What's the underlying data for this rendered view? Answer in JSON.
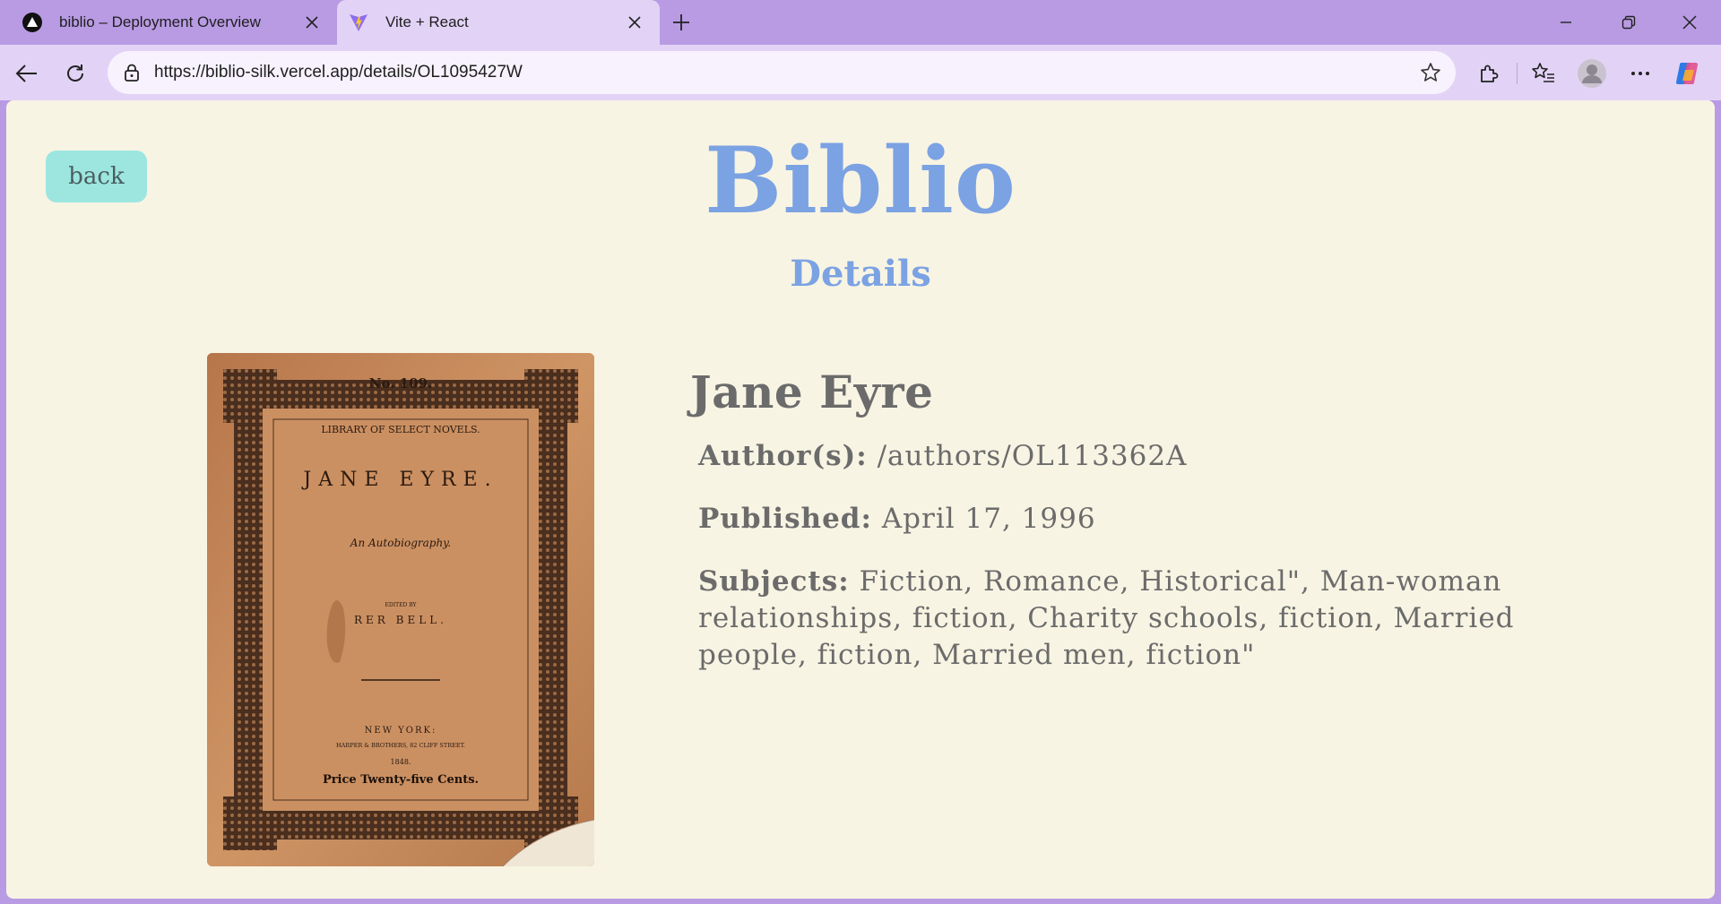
{
  "browser": {
    "tabs": [
      {
        "title": "biblio – Deployment Overview",
        "icon": "vercel-icon",
        "active": false
      },
      {
        "title": "Vite + React",
        "icon": "vite-icon",
        "active": true
      }
    ],
    "url": "https://biblio-silk.vercel.app/details/OL1095427W"
  },
  "page": {
    "back_label": "back",
    "site_title": "Biblio",
    "subtitle": "Details",
    "book": {
      "title": "Jane Eyre",
      "author_label": "Author(s):",
      "author_value": "/authors/OL113362A",
      "published_label": "Published:",
      "published_value": "April 17, 1996",
      "subjects_label": "Subjects:",
      "subjects_value": "Fiction, Romance, Historical\", Man-woman relationships, fiction, Charity schools, fiction, Married people, fiction, Married men, fiction\""
    },
    "cover": {
      "number": "No. 109.",
      "series": "LIBRARY OF SELECT NOVELS.",
      "title": "JANE EYRE.",
      "subtitle": "An Autobiography.",
      "edited_by": "EDITED BY",
      "editor": "RER BELL.",
      "city": "NEW YORK:",
      "publisher": "HARPER & BROTHERS, 82 CLIFF STREET.",
      "year": "1848.",
      "price": "Price Twenty-five Cents."
    }
  },
  "colors": {
    "accent": "#7ba2e3",
    "page_bg": "#f8f4e3",
    "back_button": "#9de6e0",
    "text": "#6b6b6b",
    "browser_frame": "#b99be4"
  }
}
